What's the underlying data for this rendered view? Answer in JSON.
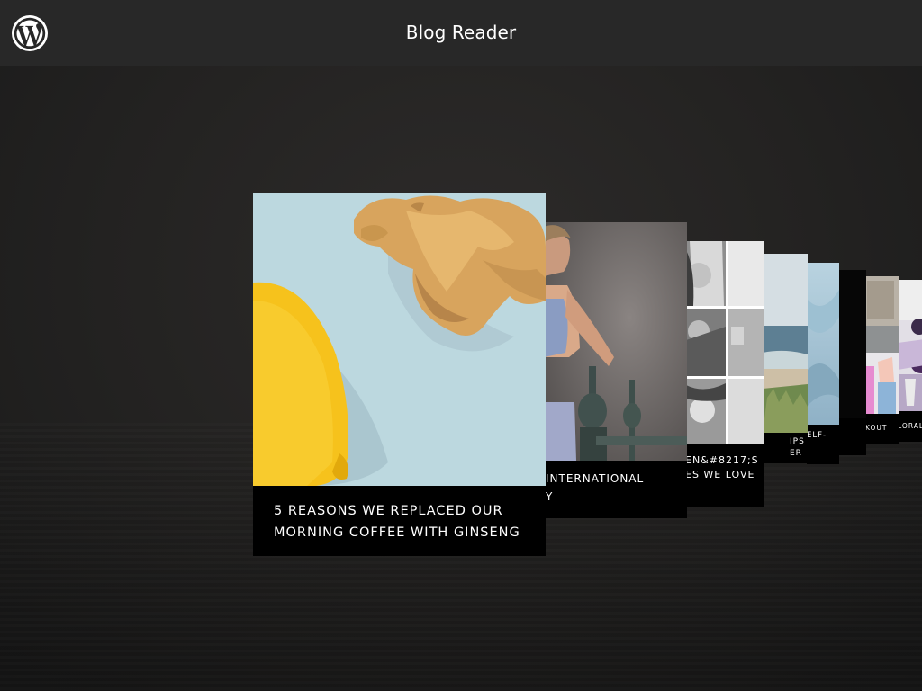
{
  "header": {
    "title": "Blog Reader",
    "logo_icon": "wordpress-logo-icon"
  },
  "posts": [
    {
      "title": "5 Reasons We Replaced Our Morning Coffee With Ginseng",
      "caption_lines": [
        "5 REASONS WE REPLACED OUR",
        "MORNING COFFEE WITH GINSENG"
      ],
      "image": "lemon-and-ginseng-root"
    },
    {
      "caption_lines": [
        "INTERNATIONAL",
        "Y"
      ],
      "image": "woman-in-sports-bra"
    },
    {
      "caption_lines": [
        "EN&#8217;S",
        "ES WE LOVE"
      ],
      "image": "black-and-white-portrait-collage"
    },
    {
      "caption_lines": [
        "IPS",
        "ER"
      ],
      "image": "beach-shoreline"
    },
    {
      "caption_lines": [
        "ELF-"
      ],
      "image": "light-blue-fabric"
    },
    {
      "caption_lines": [
        ""
      ],
      "image": "dark-photo"
    },
    {
      "caption_lines": [
        "KOUT"
      ],
      "image": "workout-group"
    },
    {
      "caption_lines": [
        "LORAL"
      ],
      "image": "floral-lifestyle"
    }
  ],
  "colors": {
    "header_bg": "#282828",
    "page_bg": "#232221",
    "caption_bg": "#000000",
    "text": "#ffffff"
  }
}
